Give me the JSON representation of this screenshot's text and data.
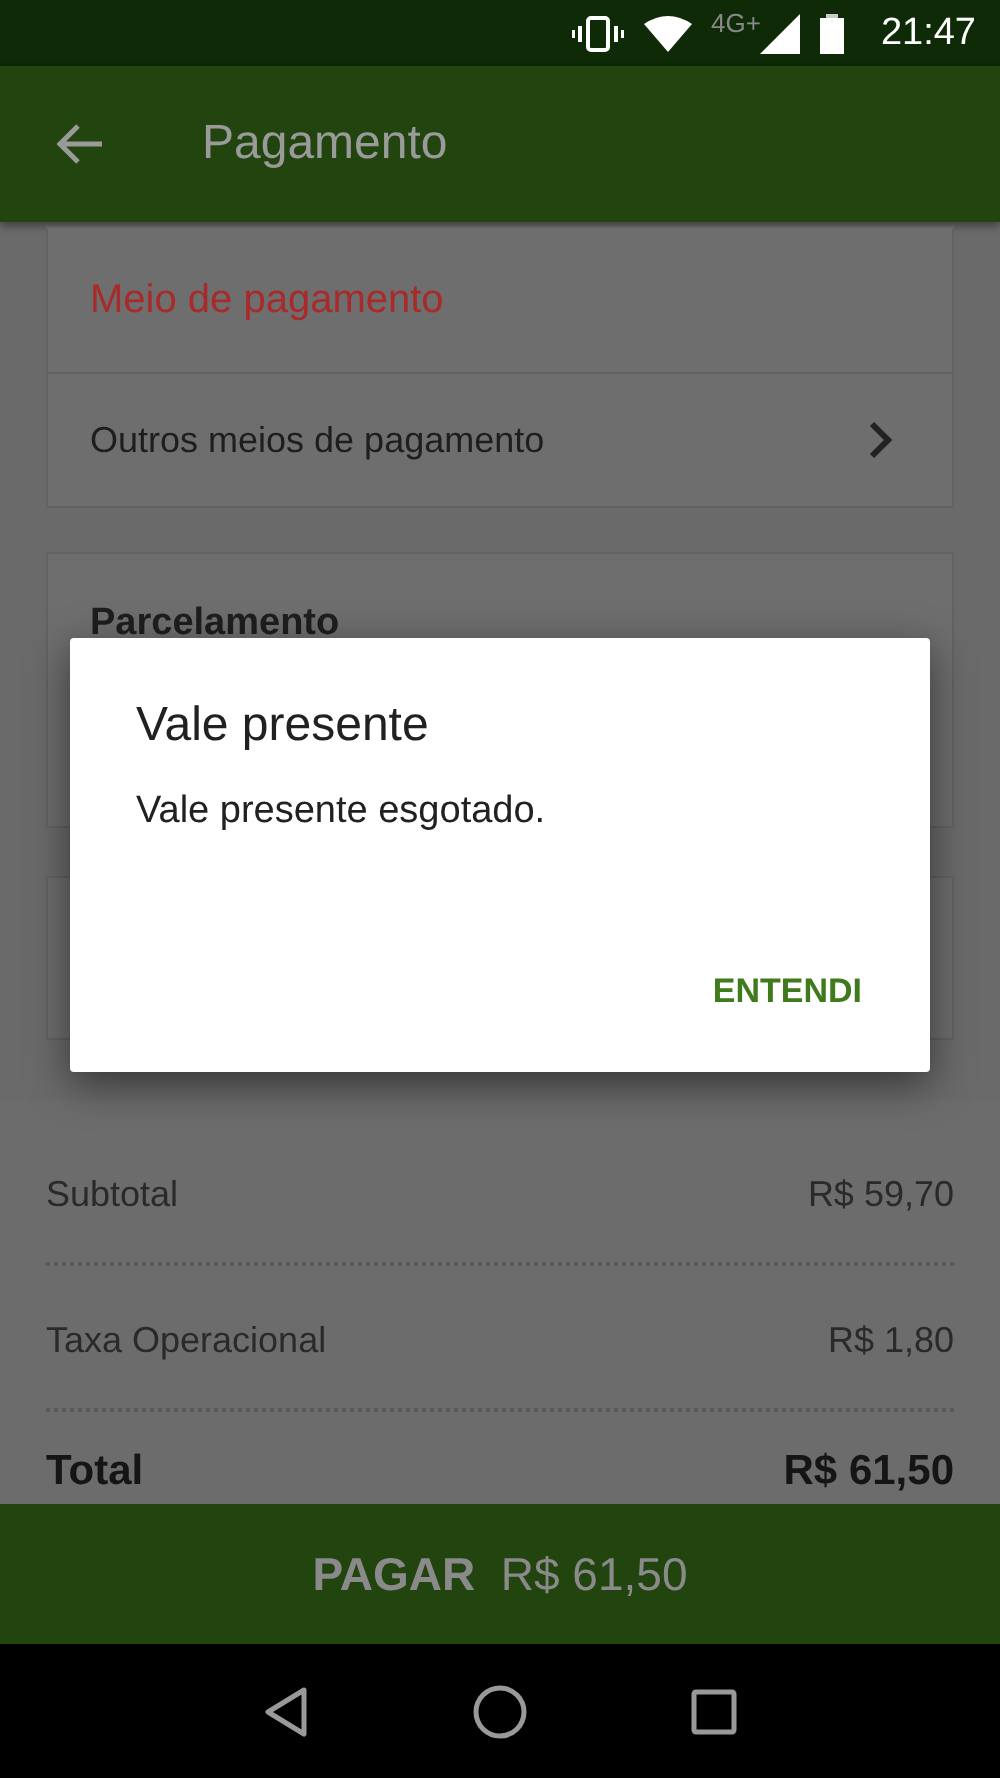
{
  "status_bar": {
    "time": "21:47",
    "network": "4G+"
  },
  "app_bar": {
    "title": "Pagamento"
  },
  "payment_card": {
    "header": "Meio de pagamento",
    "option": "Outros meios de pagamento"
  },
  "installments_card": {
    "header": "Parcelamento"
  },
  "summary": [
    {
      "label": "Subtotal",
      "value": "R$ 59,70",
      "kind": "line"
    },
    {
      "label": "Taxa Operacional",
      "value": "R$ 1,80",
      "kind": "line"
    },
    {
      "label": "Total",
      "value": "R$ 61,50",
      "kind": "total"
    }
  ],
  "pay_button": {
    "label": "PAGAR",
    "amount": "R$ 61,50"
  },
  "dialog": {
    "title": "Vale presente",
    "message": "Vale presente esgotado.",
    "action": "ENTENDI"
  }
}
